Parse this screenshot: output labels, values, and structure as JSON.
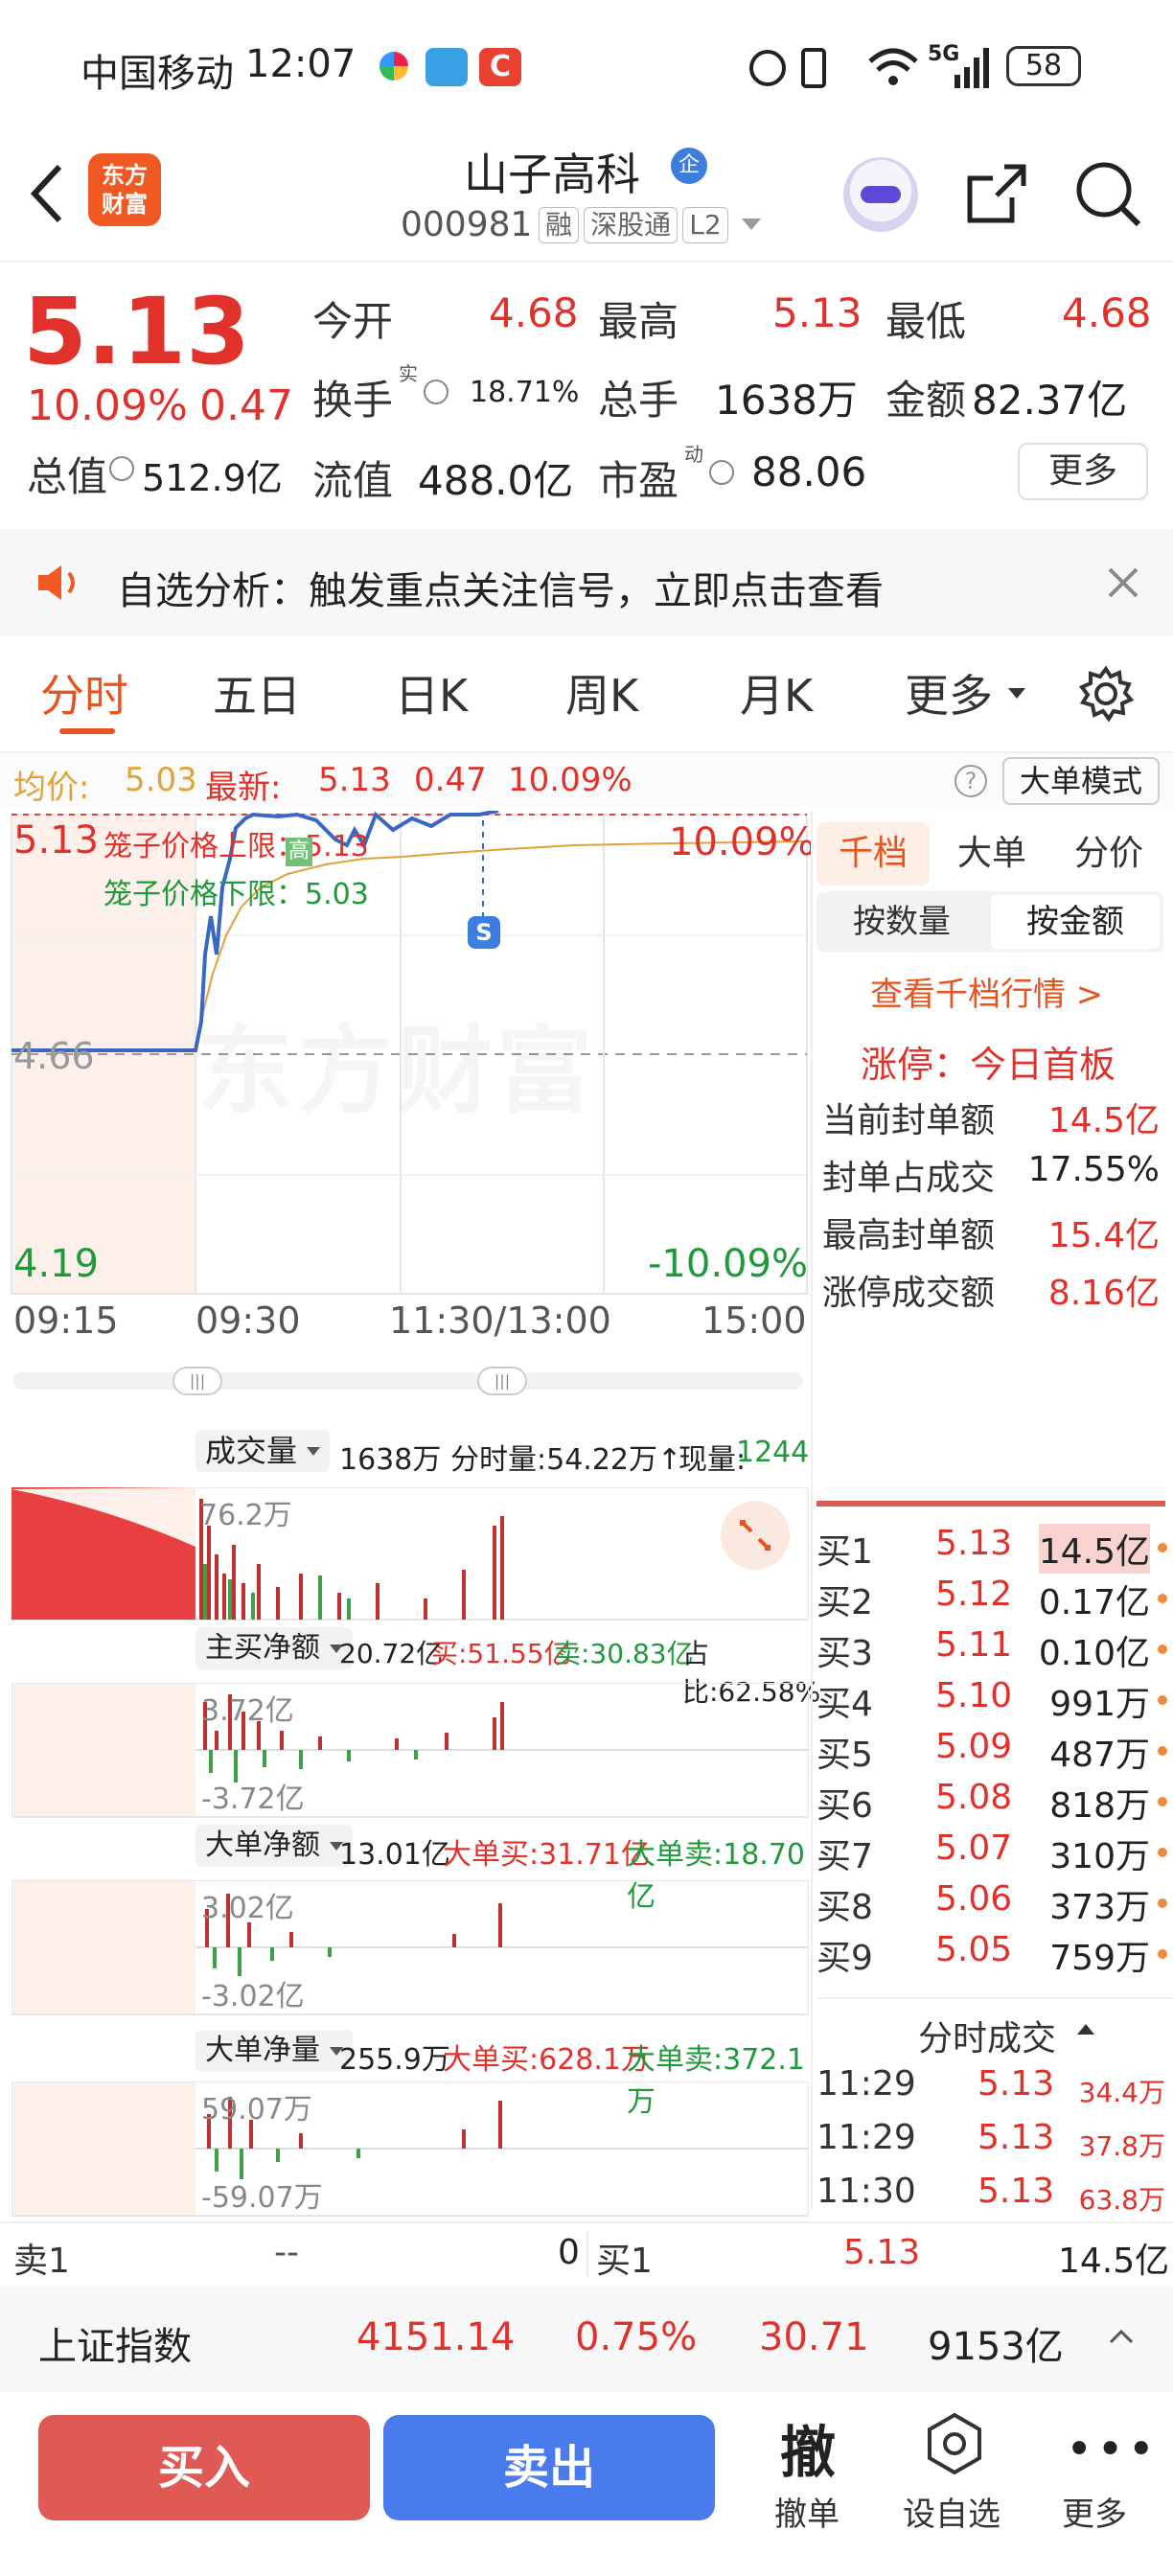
{
  "status_bar": {
    "carrier": "中国移动",
    "time": "12:07",
    "battery": "58",
    "net": "5G"
  },
  "header": {
    "name": "山子高科",
    "badge": "企",
    "code": "000981",
    "tags": [
      "融",
      "深股通",
      "L2"
    ]
  },
  "quote": {
    "price": "5.13",
    "pct": "10.09%",
    "chg": "0.47",
    "open_label": "今开",
    "open": "4.68",
    "high_label": "最高",
    "high": "5.13",
    "low_label": "最低",
    "low": "4.68",
    "turnover_label": "换手",
    "turnover_sup": "实",
    "turnover": "18.71%",
    "volume_label": "总手",
    "volume": "1638万",
    "amount_label": "金额",
    "amount": "82.37亿",
    "mktcap_label": "总值",
    "mktcap": "512.9亿",
    "float_label": "流值",
    "float": "488.0亿",
    "pe_label": "市盈",
    "pe_sup": "动",
    "pe": "88.06",
    "more": "更多"
  },
  "notice": {
    "text": "自选分析：触发重点关注信号，立即点击查看"
  },
  "tabs": [
    "分时",
    "五日",
    "日K",
    "周K",
    "月K",
    "更多"
  ],
  "chart_info": {
    "avg_label": "均价:",
    "avg": "5.03",
    "latest_label": "最新:",
    "latest": "5.13",
    "chg": "0.47",
    "pct": "10.09%",
    "mode_button": "大单模式"
  },
  "chart": {
    "top_price": "5.13",
    "top_pct": "10.09%",
    "mid_price": "4.66",
    "bottom_price": "4.19",
    "bottom_pct": "-10.09%",
    "cage_upper": "笼子价格上限：5.13",
    "cage_lower": "笼子价格下限：5.03",
    "high_tag": "高",
    "s_tag": "S",
    "watermark": "东方财富",
    "times": [
      "09:15",
      "09:30",
      "11:30/13:00",
      "15:00"
    ]
  },
  "sub_charts": {
    "volume": {
      "selector": "成交量",
      "total": "1638万",
      "period": "分时量:54.22万↑",
      "now_label": "现量:",
      "now": "1244",
      "axis": "76.2万"
    },
    "main_net": {
      "selector": "主买净额",
      "total": "20.72亿",
      "buy": "买:51.55亿",
      "sell": "卖:30.83亿",
      "ratio": "占比:62.58%",
      "top": "3.72亿",
      "bottom": "-3.72亿"
    },
    "big_net": {
      "selector": "大单净额",
      "total": "13.01亿",
      "buy": "大单买:31.71亿",
      "sell": "大单卖:18.70亿",
      "top": "3.02亿",
      "bottom": "-3.02亿"
    },
    "big_vol": {
      "selector": "大单净量",
      "total": "255.9万",
      "buy": "大单买:628.1万",
      "sell": "大单卖:372.1万",
      "top": "59.07万",
      "bottom": "-59.07万"
    }
  },
  "side_panel": {
    "tabs": [
      "千档",
      "大单",
      "分价"
    ],
    "toggles": [
      "按数量",
      "按金额"
    ],
    "link": "查看千档行情 >",
    "limit_up": "涨停：今日首板",
    "stats": [
      {
        "label": "当前封单额",
        "value": "14.5亿"
      },
      {
        "label": "封单占成交",
        "value": "17.55%"
      },
      {
        "label": "最高封单额",
        "value": "15.4亿"
      },
      {
        "label": "涨停成交额",
        "value": "8.16亿"
      }
    ],
    "book": [
      {
        "label": "买1",
        "price": "5.13",
        "vol": "14.5亿"
      },
      {
        "label": "买2",
        "price": "5.12",
        "vol": "0.17亿"
      },
      {
        "label": "买3",
        "price": "5.11",
        "vol": "0.10亿"
      },
      {
        "label": "买4",
        "price": "5.10",
        "vol": "991万"
      },
      {
        "label": "买5",
        "price": "5.09",
        "vol": "487万"
      },
      {
        "label": "买6",
        "price": "5.08",
        "vol": "818万"
      },
      {
        "label": "买7",
        "price": "5.07",
        "vol": "310万"
      },
      {
        "label": "买8",
        "price": "5.06",
        "vol": "373万"
      },
      {
        "label": "买9",
        "price": "5.05",
        "vol": "759万"
      }
    ],
    "trades_title": "分时成交",
    "trades": [
      {
        "time": "11:29",
        "price": "5.13",
        "vol": "34.4万"
      },
      {
        "time": "11:29",
        "price": "5.13",
        "vol": "37.8万"
      },
      {
        "time": "11:30",
        "price": "5.13",
        "vol": "63.8万"
      }
    ]
  },
  "bottom_bar": {
    "sell1_label": "卖1",
    "sell1_price": "--",
    "sell1_vol": "0",
    "buy1_label": "买1",
    "buy1_price": "5.13",
    "buy1_vol": "14.5亿"
  },
  "index_bar": {
    "name": "上证指数",
    "value": "4151.14",
    "pct": "0.75%",
    "chg": "30.71",
    "amount": "9153亿"
  },
  "actions": {
    "buy": "买入",
    "sell": "卖出",
    "cancel_glyph": "撤",
    "cancel": "撤单",
    "watchlist": "设自选",
    "more": "更多"
  },
  "colors": {
    "up": "#e0322b",
    "down": "#1f9a3a",
    "buy_button": "#e05a55",
    "sell_button": "#4a7bec",
    "price_line": "#3a66c4",
    "avg_line": "#e0a23a"
  }
}
